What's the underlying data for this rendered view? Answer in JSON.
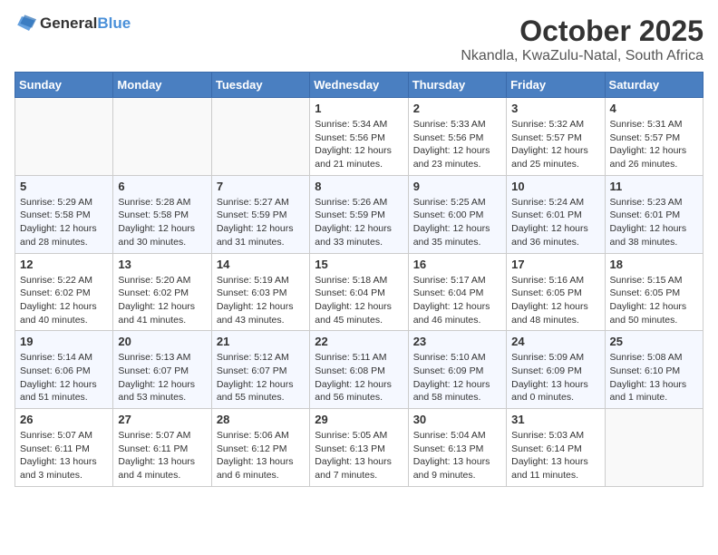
{
  "header": {
    "logo_general": "General",
    "logo_blue": "Blue",
    "title": "October 2025",
    "subtitle": "Nkandla, KwaZulu-Natal, South Africa"
  },
  "weekdays": [
    "Sunday",
    "Monday",
    "Tuesday",
    "Wednesday",
    "Thursday",
    "Friday",
    "Saturday"
  ],
  "weeks": [
    [
      {
        "day": "",
        "info": ""
      },
      {
        "day": "",
        "info": ""
      },
      {
        "day": "",
        "info": ""
      },
      {
        "day": "1",
        "info": "Sunrise: 5:34 AM\nSunset: 5:56 PM\nDaylight: 12 hours\nand 21 minutes."
      },
      {
        "day": "2",
        "info": "Sunrise: 5:33 AM\nSunset: 5:56 PM\nDaylight: 12 hours\nand 23 minutes."
      },
      {
        "day": "3",
        "info": "Sunrise: 5:32 AM\nSunset: 5:57 PM\nDaylight: 12 hours\nand 25 minutes."
      },
      {
        "day": "4",
        "info": "Sunrise: 5:31 AM\nSunset: 5:57 PM\nDaylight: 12 hours\nand 26 minutes."
      }
    ],
    [
      {
        "day": "5",
        "info": "Sunrise: 5:29 AM\nSunset: 5:58 PM\nDaylight: 12 hours\nand 28 minutes."
      },
      {
        "day": "6",
        "info": "Sunrise: 5:28 AM\nSunset: 5:58 PM\nDaylight: 12 hours\nand 30 minutes."
      },
      {
        "day": "7",
        "info": "Sunrise: 5:27 AM\nSunset: 5:59 PM\nDaylight: 12 hours\nand 31 minutes."
      },
      {
        "day": "8",
        "info": "Sunrise: 5:26 AM\nSunset: 5:59 PM\nDaylight: 12 hours\nand 33 minutes."
      },
      {
        "day": "9",
        "info": "Sunrise: 5:25 AM\nSunset: 6:00 PM\nDaylight: 12 hours\nand 35 minutes."
      },
      {
        "day": "10",
        "info": "Sunrise: 5:24 AM\nSunset: 6:01 PM\nDaylight: 12 hours\nand 36 minutes."
      },
      {
        "day": "11",
        "info": "Sunrise: 5:23 AM\nSunset: 6:01 PM\nDaylight: 12 hours\nand 38 minutes."
      }
    ],
    [
      {
        "day": "12",
        "info": "Sunrise: 5:22 AM\nSunset: 6:02 PM\nDaylight: 12 hours\nand 40 minutes."
      },
      {
        "day": "13",
        "info": "Sunrise: 5:20 AM\nSunset: 6:02 PM\nDaylight: 12 hours\nand 41 minutes."
      },
      {
        "day": "14",
        "info": "Sunrise: 5:19 AM\nSunset: 6:03 PM\nDaylight: 12 hours\nand 43 minutes."
      },
      {
        "day": "15",
        "info": "Sunrise: 5:18 AM\nSunset: 6:04 PM\nDaylight: 12 hours\nand 45 minutes."
      },
      {
        "day": "16",
        "info": "Sunrise: 5:17 AM\nSunset: 6:04 PM\nDaylight: 12 hours\nand 46 minutes."
      },
      {
        "day": "17",
        "info": "Sunrise: 5:16 AM\nSunset: 6:05 PM\nDaylight: 12 hours\nand 48 minutes."
      },
      {
        "day": "18",
        "info": "Sunrise: 5:15 AM\nSunset: 6:05 PM\nDaylight: 12 hours\nand 50 minutes."
      }
    ],
    [
      {
        "day": "19",
        "info": "Sunrise: 5:14 AM\nSunset: 6:06 PM\nDaylight: 12 hours\nand 51 minutes."
      },
      {
        "day": "20",
        "info": "Sunrise: 5:13 AM\nSunset: 6:07 PM\nDaylight: 12 hours\nand 53 minutes."
      },
      {
        "day": "21",
        "info": "Sunrise: 5:12 AM\nSunset: 6:07 PM\nDaylight: 12 hours\nand 55 minutes."
      },
      {
        "day": "22",
        "info": "Sunrise: 5:11 AM\nSunset: 6:08 PM\nDaylight: 12 hours\nand 56 minutes."
      },
      {
        "day": "23",
        "info": "Sunrise: 5:10 AM\nSunset: 6:09 PM\nDaylight: 12 hours\nand 58 minutes."
      },
      {
        "day": "24",
        "info": "Sunrise: 5:09 AM\nSunset: 6:09 PM\nDaylight: 13 hours\nand 0 minutes."
      },
      {
        "day": "25",
        "info": "Sunrise: 5:08 AM\nSunset: 6:10 PM\nDaylight: 13 hours\nand 1 minute."
      }
    ],
    [
      {
        "day": "26",
        "info": "Sunrise: 5:07 AM\nSunset: 6:11 PM\nDaylight: 13 hours\nand 3 minutes."
      },
      {
        "day": "27",
        "info": "Sunrise: 5:07 AM\nSunset: 6:11 PM\nDaylight: 13 hours\nand 4 minutes."
      },
      {
        "day": "28",
        "info": "Sunrise: 5:06 AM\nSunset: 6:12 PM\nDaylight: 13 hours\nand 6 minutes."
      },
      {
        "day": "29",
        "info": "Sunrise: 5:05 AM\nSunset: 6:13 PM\nDaylight: 13 hours\nand 7 minutes."
      },
      {
        "day": "30",
        "info": "Sunrise: 5:04 AM\nSunset: 6:13 PM\nDaylight: 13 hours\nand 9 minutes."
      },
      {
        "day": "31",
        "info": "Sunrise: 5:03 AM\nSunset: 6:14 PM\nDaylight: 13 hours\nand 11 minutes."
      },
      {
        "day": "",
        "info": ""
      }
    ]
  ]
}
